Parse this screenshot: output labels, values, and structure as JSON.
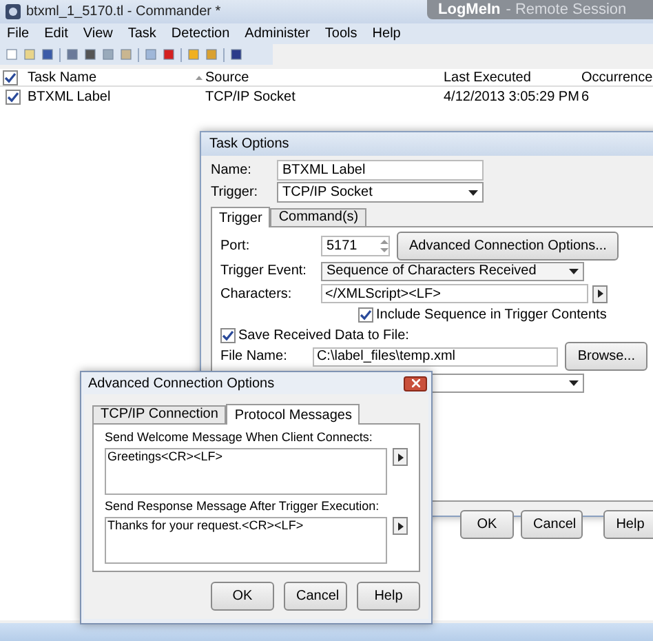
{
  "window": {
    "title": "btxml_1_5170.tl - Commander *",
    "overlay_brand": "LogMeIn",
    "overlay_text": "- Remote Session"
  },
  "menu": [
    "File",
    "Edit",
    "View",
    "Task",
    "Detection",
    "Administer",
    "Tools",
    "Help"
  ],
  "table": {
    "all_checked": true,
    "columns": [
      {
        "label": "Task Name",
        "sorted": false
      },
      {
        "label": "Source",
        "sorted": true
      },
      {
        "label": "Last Executed",
        "sorted": false
      },
      {
        "label": "Occurrence",
        "sorted": false
      }
    ],
    "rows": [
      {
        "checked": true,
        "cells": [
          "BTXML Label",
          "TCP/IP Socket",
          "4/12/2013 3:05:29 PM",
          "6"
        ]
      }
    ]
  },
  "task_options": {
    "title": "Task Options",
    "name_label": "Name:",
    "name_value": "BTXML Label",
    "trigger_label": "Trigger:",
    "trigger_value": "TCP/IP Socket",
    "tabs": [
      {
        "label": "Trigger",
        "selected": true
      },
      {
        "label": "Command(s)",
        "selected": false
      }
    ],
    "port_label": "Port:",
    "port_value": "5171",
    "advanced_button": "Advanced Connection Options...",
    "event_label": "Trigger Event:",
    "event_value": "Sequence of Characters Received",
    "characters_label": "Characters:",
    "characters_value": "</XMLScript><LF>",
    "include_sequence": {
      "label": "Include Sequence in Trigger Contents",
      "checked": true
    },
    "save_data": {
      "label": "Save Received Data to File:",
      "checked": true
    },
    "file_label": "File Name:",
    "file_value": "C:\\label_files\\temp.xml",
    "browse_button": "Browse...",
    "buttons": [
      "OK",
      "Cancel",
      "Help"
    ]
  },
  "advanced": {
    "title": "Advanced Connection Options",
    "tabs": [
      {
        "label": "TCP/IP Connection",
        "selected": false
      },
      {
        "label": "Protocol Messages",
        "selected": true
      }
    ],
    "welcome_label": "Send Welcome Message When Client Connects:",
    "welcome_value": "Greetings<CR><LF>",
    "response_label": "Send Response Message After Trigger Execution:",
    "response_value": "Thanks for your request.<CR><LF>",
    "buttons": [
      "OK",
      "Cancel",
      "Help"
    ]
  }
}
